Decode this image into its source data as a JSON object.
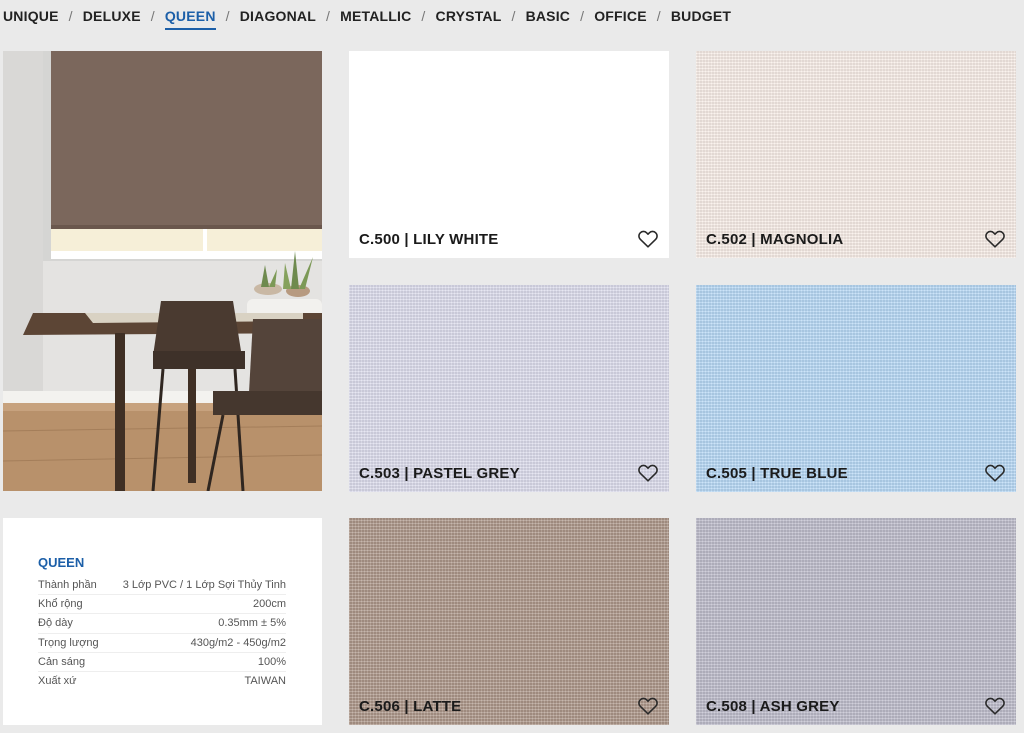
{
  "nav": {
    "items": [
      {
        "label": "UNIQUE",
        "active": false
      },
      {
        "label": "DELUXE",
        "active": false
      },
      {
        "label": "QUEEN",
        "active": true
      },
      {
        "label": "DIAGONAL",
        "active": false
      },
      {
        "label": "METALLIC",
        "active": false
      },
      {
        "label": "CRYSTAL",
        "active": false
      },
      {
        "label": "BASIC",
        "active": false
      },
      {
        "label": "OFFICE",
        "active": false
      },
      {
        "label": "BUDGET",
        "active": false
      }
    ],
    "separator": "/",
    "active_color": "#1c5fa8"
  },
  "spec": {
    "title": "QUEEN",
    "rows": [
      {
        "key": "Thành phần",
        "value": "3 Lớp PVC / 1 Lớp Sợi Thủy Tinh"
      },
      {
        "key": "Khổ rộng",
        "value": "200cm"
      },
      {
        "key": "Độ dày",
        "value": "0.35mm ± 5%"
      },
      {
        "key": "Trọng lượng",
        "value": "430g/m2 - 450g/m2"
      },
      {
        "key": "Cản sáng",
        "value": "100%"
      },
      {
        "key": "Xuất xứ",
        "value": "TAIWAN"
      }
    ]
  },
  "swatches": [
    {
      "label": "C.500 | LILY WHITE",
      "color": "#ffffff",
      "plain": true
    },
    {
      "label": "C.502 | MAGNOLIA",
      "color": "#f8ede7",
      "plain": false
    },
    {
      "label": "C.503 | PASTEL GREY",
      "color": "#dcdcec",
      "plain": false
    },
    {
      "label": "C.505 | TRUE BLUE",
      "color": "#b7d8f6",
      "plain": false
    },
    {
      "label": "C.506 | LATTE",
      "color": "#ad978a",
      "plain": false
    },
    {
      "label": "C.508 | ASH GREY",
      "color": "#bdbccb",
      "plain": false
    }
  ],
  "icons": {
    "favorite": "heart-outline-icon"
  }
}
